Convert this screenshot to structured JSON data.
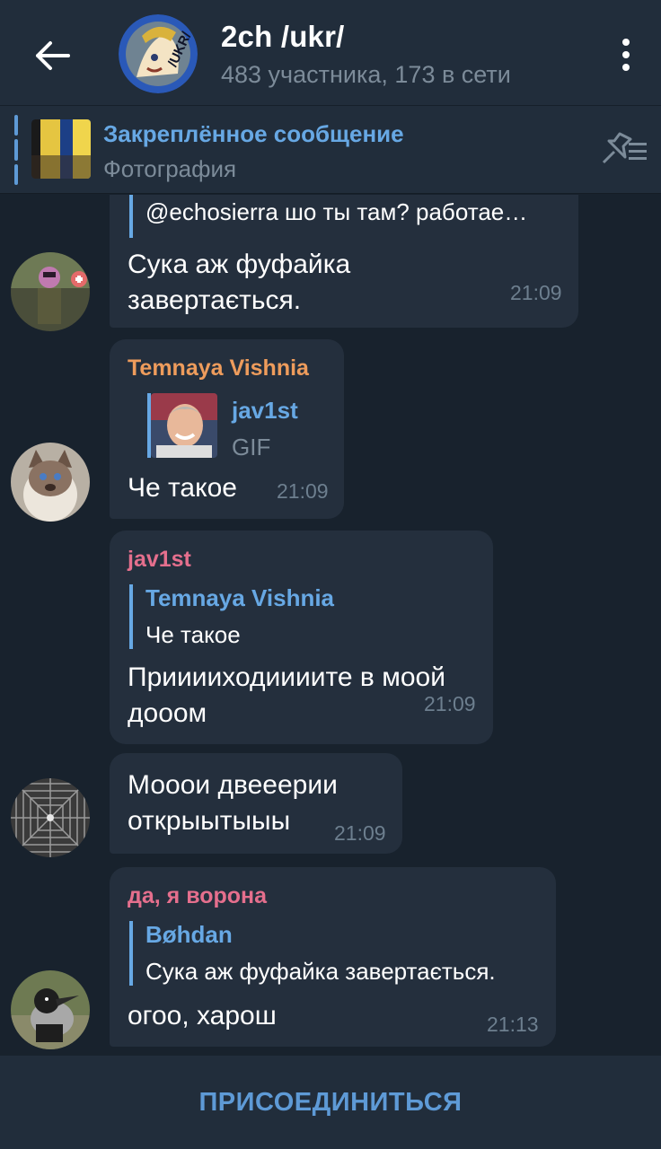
{
  "header": {
    "title": "2ch /ukr/",
    "subtitle": "483 участника, 173 в сети",
    "avatar_text": "/UKR/"
  },
  "pinned": {
    "title": "Закреплённое сообщение",
    "subtitle": "Фотография"
  },
  "messages": [
    {
      "reply_text": "@echosierra шо ты там? работае…",
      "text_lines": [
        "Сука аж фуфайка",
        "завертається."
      ],
      "time": "21:09"
    },
    {
      "sender": "Temnaya Vishnia",
      "reply_name": "jav1st",
      "reply_text": "GIF",
      "text": "Че такое",
      "time": "21:09"
    },
    {
      "sender": "jav1st",
      "reply_name": "Temnaya Vishnia",
      "reply_text": "Че такое",
      "text_lines": [
        "Прииииходиииите в моой",
        "дооом"
      ],
      "time": "21:09"
    },
    {
      "text_lines": [
        "Мооои двееерии",
        "открыытыыы"
      ],
      "time": "21:09"
    },
    {
      "sender": "да, я ворона",
      "reply_name": "Bøhdan",
      "reply_text": "Сука аж фуфайка завертається.",
      "text": "огоо, харош",
      "time": "21:13"
    }
  ],
  "join_button": "ПРИСОЕДИНИТЬСЯ",
  "colors": {
    "background": "#18222d",
    "bar": "#212d3b",
    "bubble": "#242f3d",
    "accent": "#67a8e4",
    "sender_orange": "#ee9c5c",
    "sender_pink": "#e56f8d",
    "meta": "#6d7f8f"
  }
}
